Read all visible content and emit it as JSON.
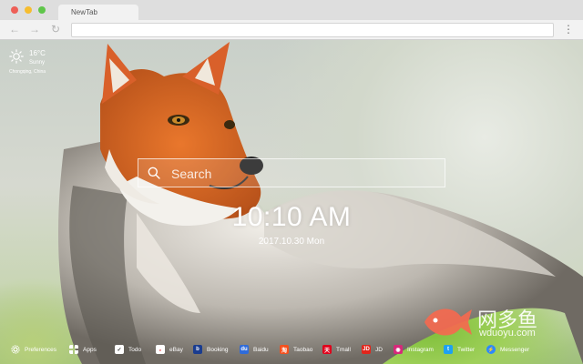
{
  "browser": {
    "tab_title": "NewTab",
    "address": "",
    "icons": {
      "back": "back-arrow-icon",
      "forward": "forward-arrow-icon",
      "reload": "reload-icon",
      "menu": "menu-icon"
    }
  },
  "weather": {
    "temperature": "16°C",
    "condition": "Sunny",
    "location": "Chongqing,  China",
    "icon": "sun-icon"
  },
  "search": {
    "placeholder": "Search"
  },
  "clock": {
    "time": "10:10 AM",
    "date": "2017.10.30 Mon"
  },
  "watermark": {
    "chinese": "网多鱼",
    "site": "wduoyu.com",
    "accent": "#f4694f"
  },
  "bottom_bar": {
    "items": [
      {
        "label": "Preferences",
        "icon": "gear-icon",
        "color": "transparent"
      },
      {
        "label": "Apps",
        "icon": "grid-icon",
        "color": "transparent"
      },
      {
        "label": "Todo",
        "icon": "checkbox-icon",
        "color": "#ffffff"
      },
      {
        "label": "eBay",
        "icon": "ebay-icon",
        "color": "#ffffff"
      },
      {
        "label": "Booking",
        "icon": "booking-icon",
        "color": "#1a3c8f"
      },
      {
        "label": "Baidu",
        "icon": "baidu-icon",
        "color": "#2f6bd9"
      },
      {
        "label": "Taobao",
        "icon": "taobao-icon",
        "color": "#f5501e"
      },
      {
        "label": "Tmall",
        "icon": "tmall-icon",
        "color": "#e0001b"
      },
      {
        "label": "JD",
        "icon": "jd-icon",
        "color": "#e1251b"
      },
      {
        "label": "Instagram",
        "icon": "instagram-icon",
        "color": "#d6297a"
      },
      {
        "label": "Twitter",
        "icon": "twitter-icon",
        "color": "#1da1f2"
      },
      {
        "label": "Messenger",
        "icon": "messenger-icon",
        "color": "#2d88ff"
      }
    ]
  }
}
